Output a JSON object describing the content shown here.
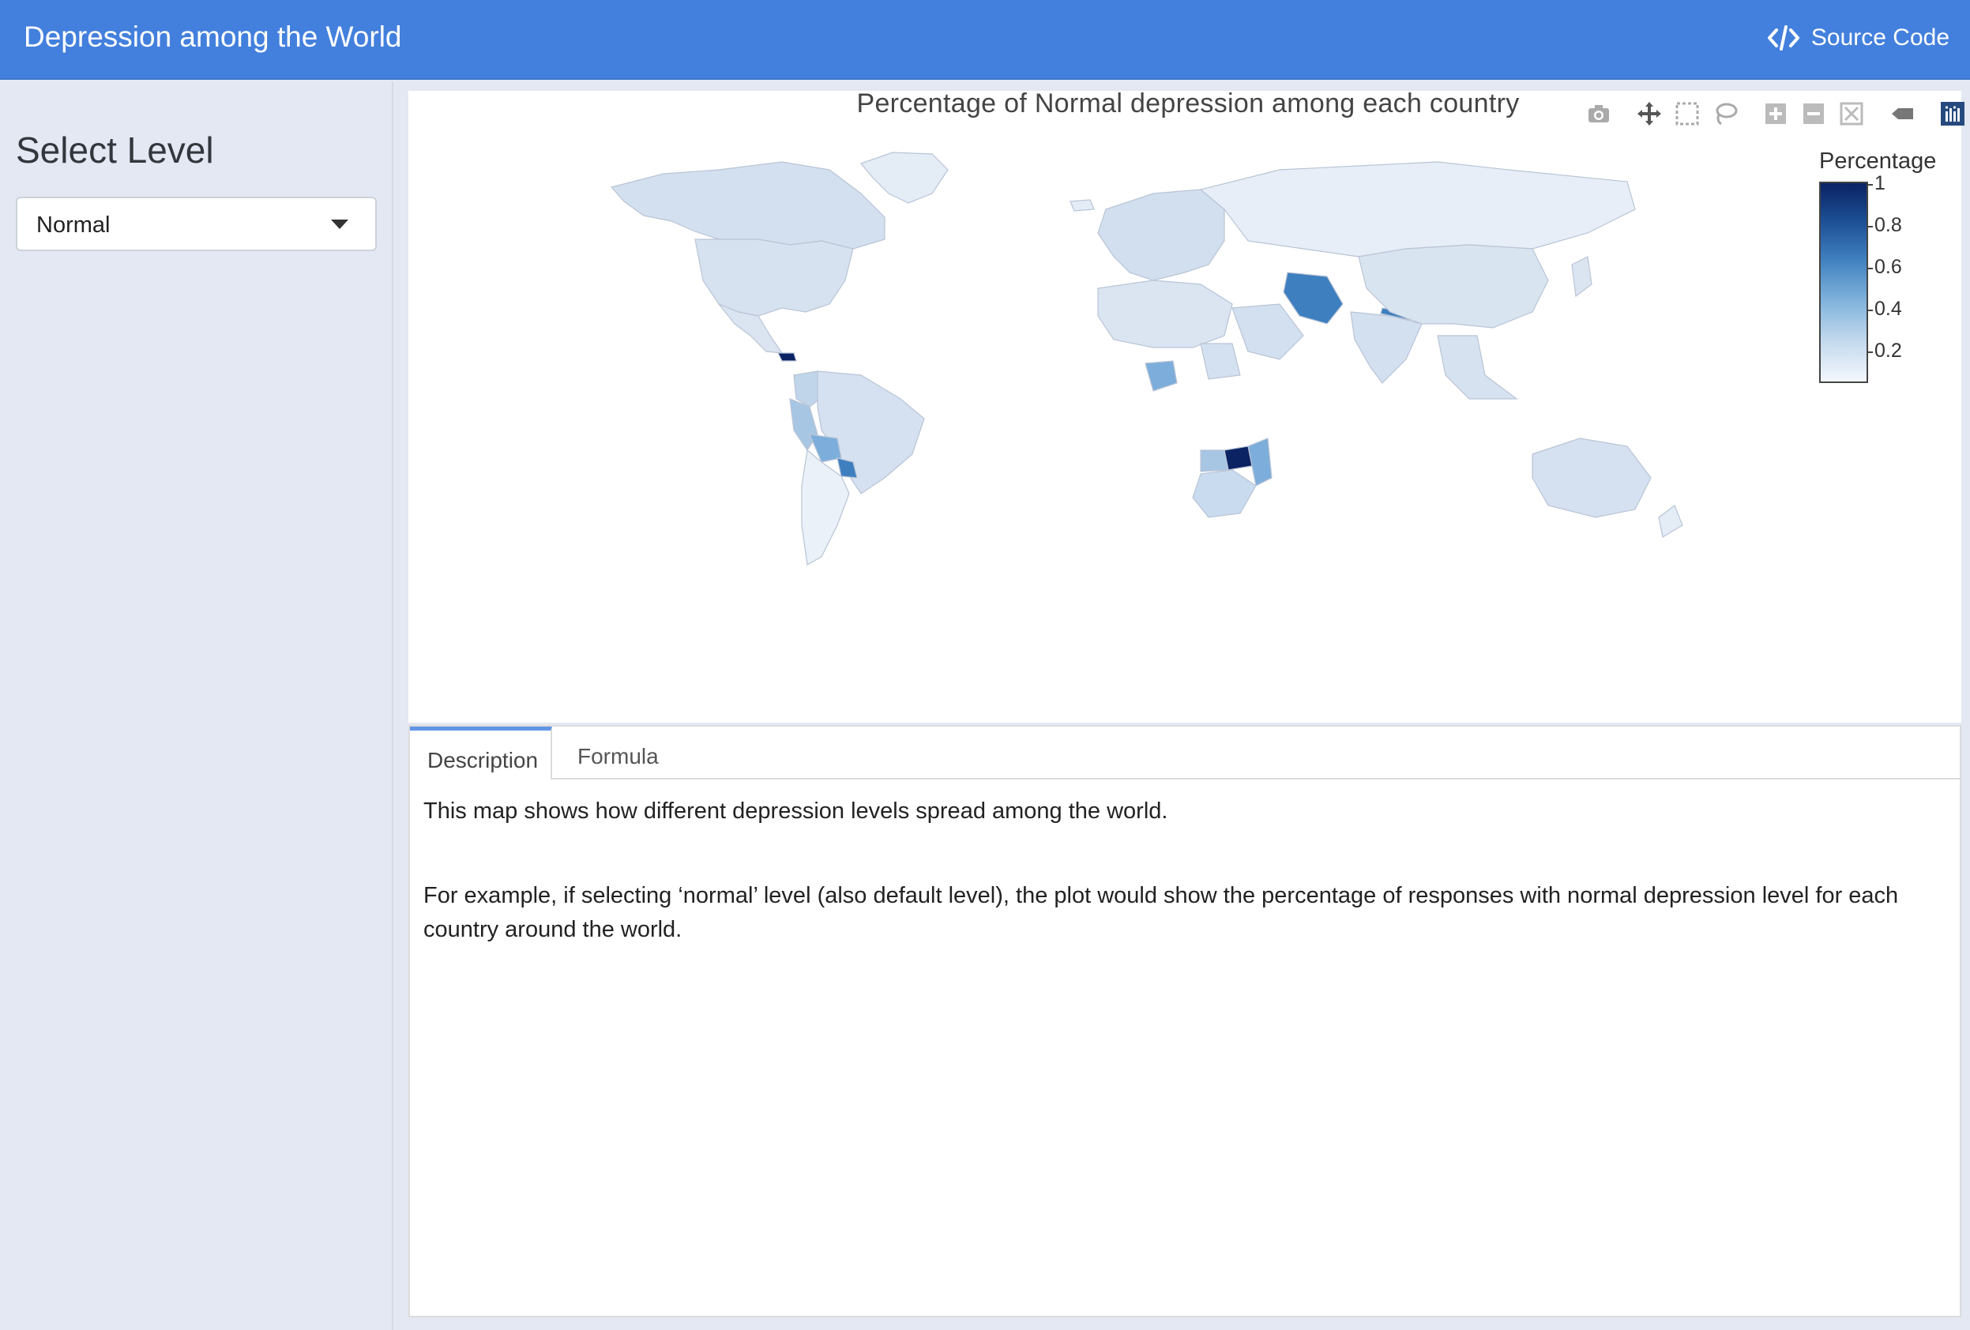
{
  "app": {
    "title": "Depression among the World",
    "source_code_label": "Source Code"
  },
  "sidebar": {
    "heading": "Select Level",
    "select": {
      "value": "Normal"
    }
  },
  "plot": {
    "title": "Percentage of Normal depression among each country",
    "modebar_icons": [
      "camera-icon",
      "pan-icon",
      "box-select-icon",
      "lasso-icon",
      "zoom-in-icon",
      "zoom-out-icon",
      "autoscale-icon",
      "hover-icon",
      "plotly-logo-icon"
    ],
    "colorbar": {
      "title": "Percentage",
      "ticks": [
        "1",
        "0.8",
        "0.6",
        "0.4",
        "0.2"
      ],
      "colors": [
        "#0b2263",
        "#3e7fbf",
        "#c4daee",
        "#f4f7fc"
      ]
    },
    "chart_data": {
      "type": "choropleth",
      "title": "Percentage of Normal depression among each country",
      "color_range": [
        0,
        1
      ],
      "legend_title": "Percentage"
    }
  },
  "tabs": {
    "items": [
      {
        "label": "Description"
      },
      {
        "label": "Formula"
      }
    ],
    "active": "Description",
    "description": {
      "p1": "This map shows how different depression levels spread among the world.",
      "p2": "For example, if selecting ‘normal’ level (also default level), the plot would show the percentage of responses with normal depression level for each country around the world."
    }
  }
}
